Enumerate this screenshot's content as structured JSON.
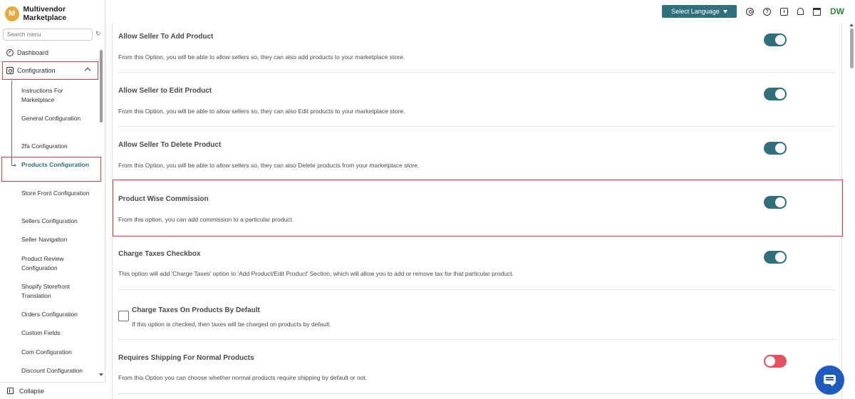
{
  "app": {
    "logo_letter": "M",
    "title": "Multivendor Marketplace",
    "accent_color": "#2f6f7e",
    "highlight_color": "#e0393e"
  },
  "sidebar": {
    "search_placeholder": "Search menu",
    "dashboard_label": "Dashboard",
    "configuration_label": "Configuration",
    "sub_items": [
      {
        "label": "Instructions For Marketplace"
      },
      {
        "label": "General Configuration"
      },
      {
        "label": "2fa Configuration"
      },
      {
        "label": "Products Configuration"
      },
      {
        "label": "Store Front Configuration"
      },
      {
        "label": "Sellers Configuration"
      },
      {
        "label": "Seller Navigation"
      },
      {
        "label": "Product Review Configuration"
      },
      {
        "label": "Shopify Storefront Translation"
      },
      {
        "label": "Orders Configuration"
      },
      {
        "label": "Custom Fields"
      },
      {
        "label": "Com Configuration"
      },
      {
        "label": "Discount Configuration"
      }
    ],
    "collapse_label": "Collapse"
  },
  "topbar": {
    "language_button": "Select Language",
    "help_glyph": "?",
    "avatar_initials": "DW"
  },
  "settings": [
    {
      "title": "Allow Seller To Add Product",
      "description": "From this Option, you will be able to allow sellers so, they can also add products to your marketplace store.",
      "enabled": true
    },
    {
      "title": "Allow Seller to Edit Product",
      "description": "From this Option, you will be able to allow sellers so, they can also Edit products to your marketplace store.",
      "enabled": true
    },
    {
      "title": "Allow Seller To Delete Product",
      "description": "From this Option, you will be able to allow sellers so, they can also Delete products from your marketplace store.",
      "enabled": true
    },
    {
      "title": "Product Wise Commission",
      "description": "From this option, you can add commission to a particular product.",
      "enabled": true
    },
    {
      "title": "Charge Taxes Checkbox",
      "description": "This option will add 'Charge Taxes' option to 'Add Product/Edit Product' Section, which will allow you to add or remove tax for that particular product.",
      "enabled": true
    },
    {
      "title": "Charge Taxes On Products By Default",
      "description": "If this option is checked, then taxes will be charged on products by default.",
      "checked": false
    },
    {
      "title": "Requires Shipping For Normal Products",
      "description": "From this Option you can choose whether normal products require shipping by default or not.",
      "enabled": false
    }
  ]
}
